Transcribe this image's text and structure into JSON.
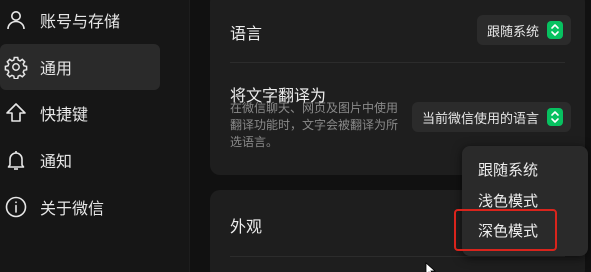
{
  "sidebar": {
    "items": [
      {
        "label": "账号与存储",
        "icon": "user-icon",
        "active": false
      },
      {
        "label": "通用",
        "icon": "gear-icon",
        "active": true
      },
      {
        "label": "快捷键",
        "icon": "shortcut-arrow-icon",
        "active": false
      },
      {
        "label": "通知",
        "icon": "bell-icon",
        "active": false
      },
      {
        "label": "关于微信",
        "icon": "info-icon",
        "active": false
      }
    ]
  },
  "settings": {
    "language": {
      "title": "语言",
      "value": "跟随系统"
    },
    "translate": {
      "title": "将文字翻译为",
      "description": "在微信聊天、网页及图片中使用翻译功能时，文字会被翻译为所选语言。",
      "value": "当前微信使用的语言"
    },
    "appearance": {
      "title": "外观"
    }
  },
  "appearance_menu": {
    "options": [
      "跟随系统",
      "浅色模式",
      "深色模式"
    ],
    "highlighted": "深色模式"
  },
  "colors": {
    "accent": "#07c160",
    "highlight_border": "#d9241c"
  }
}
